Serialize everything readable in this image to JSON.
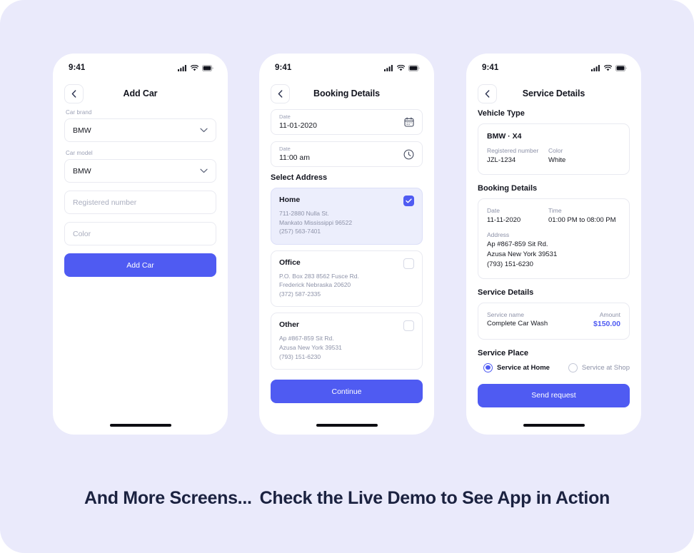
{
  "theme": {
    "page_bg": "#ffffff",
    "canvas_bg": "#eaeafb",
    "accent": "#4f5bf2",
    "selected_card_bg": "#eceefc",
    "text_dark": "#12141e",
    "text_muted": "#8d92a8",
    "border": "#e9eaf1"
  },
  "status_bar": {
    "time": "9:41",
    "icons": [
      "cellular-signal-icon",
      "wifi-icon",
      "battery-icon"
    ]
  },
  "screens": [
    {
      "id": "add-car",
      "nav": {
        "back_icon": "chevron-left-icon",
        "title": "Add Car"
      },
      "fields": [
        {
          "label": "Car brand",
          "value": "BMW",
          "type": "select",
          "icon": "chevron-down-icon"
        },
        {
          "label": "Car model",
          "value": "BMW",
          "type": "select",
          "icon": "chevron-down-icon"
        },
        {
          "label": "",
          "placeholder": "Registered number",
          "value": "",
          "type": "text"
        },
        {
          "label": "",
          "placeholder": "Color",
          "value": "",
          "type": "text"
        }
      ],
      "submit_label": "Add Car"
    },
    {
      "id": "booking-details",
      "nav": {
        "back_icon": "chevron-left-icon",
        "title": "Booking Details"
      },
      "datetime_fields": [
        {
          "label": "Date",
          "value": "11-01-2020",
          "icon": "calendar-icon"
        },
        {
          "label": "Date",
          "value": "11:00 am",
          "icon": "clock-icon"
        }
      ],
      "address_section_title": "Select Address",
      "addresses": [
        {
          "name": "Home",
          "lines": [
            "711-2880 Nulla St.",
            "Mankato Mississippi 96522",
            "(257) 563-7401"
          ],
          "selected": true
        },
        {
          "name": "Office",
          "lines": [
            "P.O. Box 283 8562 Fusce Rd.",
            "Frederick Nebraska 20620",
            "(372) 587-2335"
          ],
          "selected": false
        },
        {
          "name": "Other",
          "lines": [
            "Ap #867-859 Sit Rd.",
            "Azusa New York 39531",
            "(793) 151-6230"
          ],
          "selected": false
        }
      ],
      "submit_label": "Continue"
    },
    {
      "id": "service-details",
      "nav": {
        "back_icon": "chevron-left-icon",
        "title": "Service Details"
      },
      "vehicle": {
        "section_title": "Vehicle Type",
        "name": "BMW · X4",
        "registered_number_label": "Registered number",
        "registered_number": "JZL-1234",
        "color_label": "Color",
        "color": "White"
      },
      "booking": {
        "section_title": "Booking Details",
        "date_label": "Date",
        "date": "11-11-2020",
        "time_label": "Time",
        "time": "01:00 PM to 08:00 PM",
        "address_label": "Address",
        "address_lines": [
          "Ap #867-859 Sit Rd.",
          "Azusa New York 39531",
          "(793) 151-6230"
        ]
      },
      "service": {
        "section_title": "Service Details",
        "name_label": "Service name",
        "name": "Complete Car Wash",
        "amount_label": "Amount",
        "amount": "$150.00"
      },
      "service_place": {
        "section_title": "Service Place",
        "options": [
          {
            "label": "Service at Home",
            "selected": true
          },
          {
            "label": "Service at Shop",
            "selected": false
          }
        ]
      },
      "submit_label": "Send request"
    }
  ],
  "caption": {
    "part1": "And More Screens...",
    "part2": "Check the Live Demo to See App in Action"
  }
}
